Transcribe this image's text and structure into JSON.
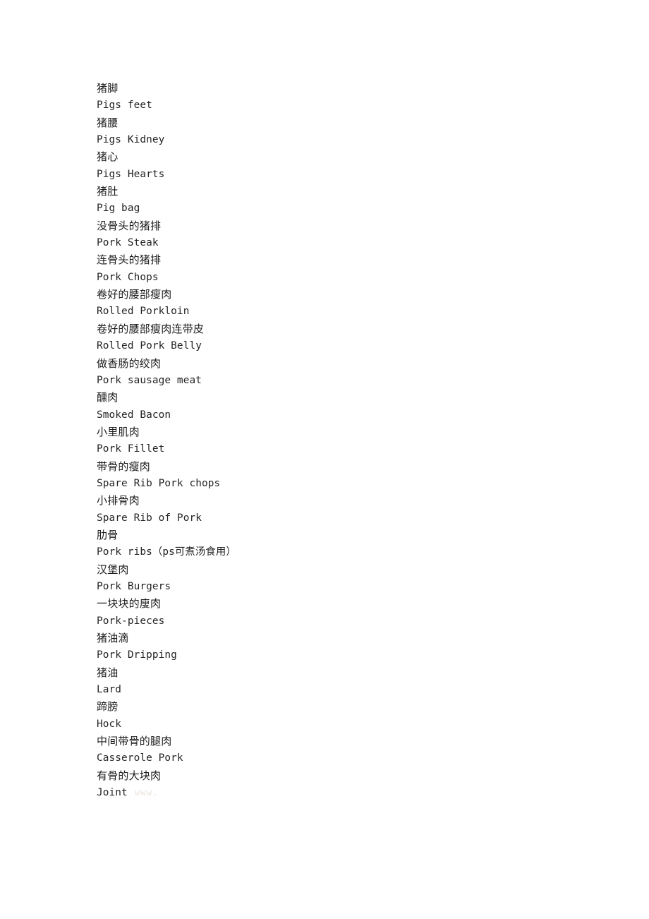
{
  "document": {
    "background_color": "#ffffff",
    "text_color": "#1c1c1c",
    "watermark_color": "#eae7de",
    "watermark": "www.",
    "entries": [
      {
        "zh": "猪脚",
        "en": "Pigs feet"
      },
      {
        "zh": "猪腰",
        "en": "Pigs Kidney"
      },
      {
        "zh": "猪心",
        "en": "Pigs Hearts"
      },
      {
        "zh": "猪肚",
        "en": "Pig bag"
      },
      {
        "zh": "没骨头的猪排",
        "en": "Pork Steak"
      },
      {
        "zh": "连骨头的猪排",
        "en": "Pork Chops"
      },
      {
        "zh": "卷好的腰部瘦肉",
        "en": "Rolled Porkloin"
      },
      {
        "zh": "卷好的腰部瘦肉连带皮",
        "en": "Rolled Pork Belly"
      },
      {
        "zh": "做香肠的绞肉",
        "en": "Pork sausage meat"
      },
      {
        "zh": "醺肉",
        "en": "Smoked Bacon"
      },
      {
        "zh": "小里肌肉",
        "en": "Pork Fillet"
      },
      {
        "zh": "带骨的瘦肉",
        "en": "Spare Rib Pork chops"
      },
      {
        "zh": "小排骨肉",
        "en": "Spare Rib of Pork"
      },
      {
        "zh": "肋骨",
        "en": "Pork ribs（ps可煮汤食用）"
      },
      {
        "zh": "汉堡肉",
        "en": "Pork Burgers"
      },
      {
        "zh": "一块块的廋肉",
        "en": "Pork-pieces"
      },
      {
        "zh": "猪油滴",
        "en": "Pork Dripping"
      },
      {
        "zh": "猪油",
        "en": "Lard"
      },
      {
        "zh": "蹄膀",
        "en": "Hock"
      },
      {
        "zh": "中间带骨的腿肉",
        "en": "Casserole Pork"
      },
      {
        "zh": "有骨的大块肉",
        "en": "Joint"
      }
    ]
  }
}
